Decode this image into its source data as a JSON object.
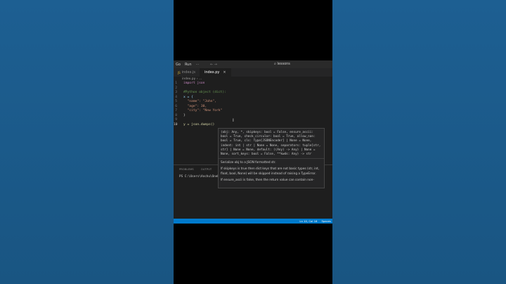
{
  "titlebar": {
    "menu_go": "Go",
    "menu_run": "Run",
    "menu_more": "···",
    "nav_arrows": "← →",
    "search": "⌕ lessons"
  },
  "tabs": [
    {
      "icon": "JS",
      "label": "index.js",
      "active": false
    },
    {
      "icon": "py",
      "label": "index.py",
      "active": true,
      "close": "×"
    }
  ],
  "breadcrumb": "index.py › ...",
  "code_lines": [
    {
      "n": "1",
      "text": "import json"
    },
    {
      "n": "2",
      "text": ""
    },
    {
      "n": "3",
      "text": "#Python object (dict):"
    },
    {
      "n": "4",
      "text": "x = {"
    },
    {
      "n": "5",
      "text": "  \"name\": \"John\","
    },
    {
      "n": "6",
      "text": "  \"age\": 30,"
    },
    {
      "n": "7",
      "text": "  \"city\": \"New York\""
    },
    {
      "n": "8",
      "text": "}"
    },
    {
      "n": "9",
      "text": ""
    },
    {
      "n": "10",
      "text": "y = json.dumps()"
    }
  ],
  "tooltip": {
    "signature": "(obj: Any, *, skipkeys: bool = False, ensure_ascii: bool = True, check_circular: bool = True, allow_nan: bool = True, cls: Type[JSONEncoder] | None = None, indent: int | str | None = None, separators: tuple[str, str] | None = None, default: ((Any) -> Any) | None = None, sort_keys: bool = False, **kwds: Any) -> str",
    "doc1": "Serialize obj to a JSON formatted str.",
    "doc2": "If skipkeys is true then dict keys that are not basic types (str, int, float, bool, None) will be skipped instead of raising a TypeError.",
    "doc3": "If ensure_ascii is false, then the return value can contain non-"
  },
  "panel": {
    "tabs": [
      "PROBLEMS",
      "OUTPUT",
      "DEBUG CONSOLE",
      "TERMINAL"
    ],
    "terminal_line": "PS C:\\Users\\Anchu\\OneD"
  },
  "statusbar": {
    "position": "Ln 10, Col 16",
    "spaces": "Spaces"
  }
}
